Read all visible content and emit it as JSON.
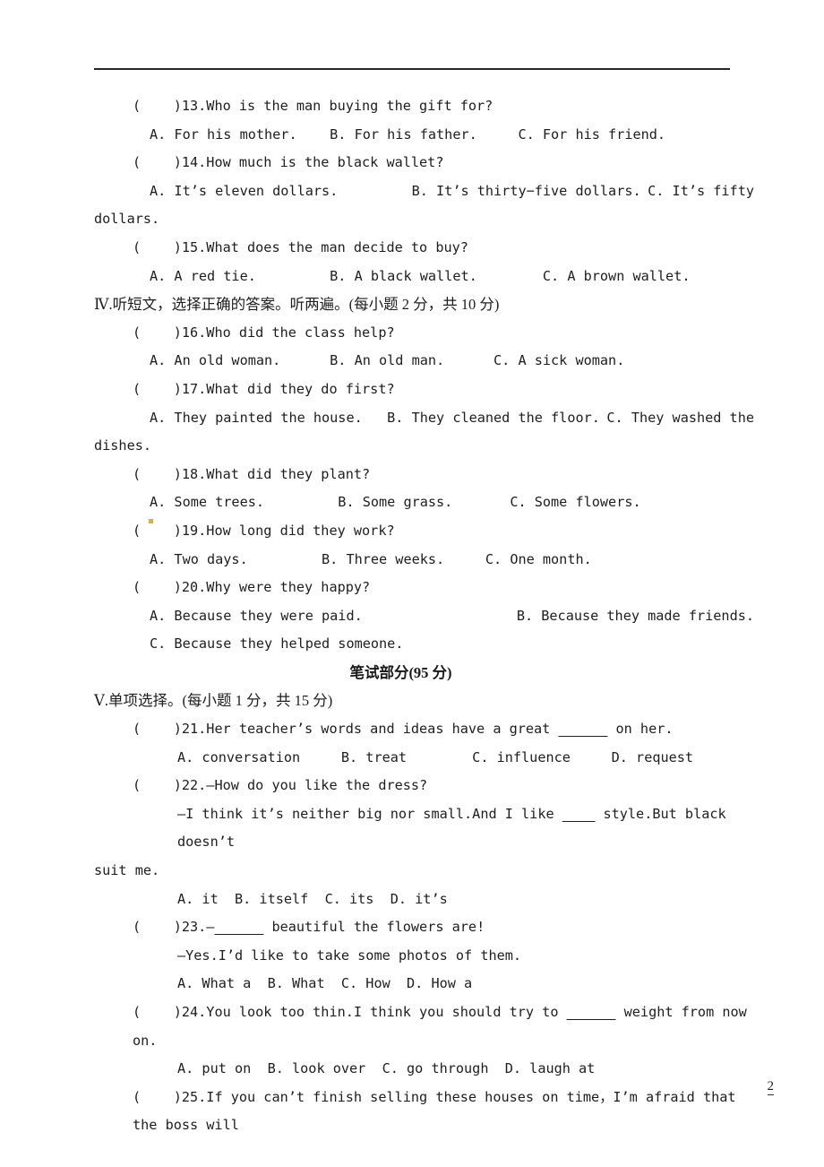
{
  "page": {
    "number": "2",
    "rule_color": "#262626"
  },
  "listening_section_3": {
    "questions": [
      {
        "marker": "(    )13.",
        "stem": "Who is the man buying the gift for?",
        "options_line": "A. For his mother.    B. For his father.     C. For his friend."
      },
      {
        "marker": "(    )14.",
        "stem": "How much is the black wallet?",
        "options_line_left": "A. It’s eleven dollars.         B. It’s thirty−five dollars.",
        "options_line_right": "C. It’s fifty",
        "options_wrap": "dollars."
      },
      {
        "marker": "(    )15.",
        "stem": "What does the man decide to buy?",
        "options_line": "A. A red tie.         B. A black wallet.        C. A brown wallet."
      }
    ]
  },
  "section_iv": {
    "heading": "Ⅳ.听短文，选择正确的答案。听两遍。(每小题 2 分，共 10 分)",
    "questions": [
      {
        "marker": "(    )16.",
        "stem": "Who did the class help?",
        "options_line": "A. An old woman.      B. An old man.      C. A sick woman."
      },
      {
        "marker": "(    )17.",
        "stem": "What did they do first?",
        "options_line_left": "A. They painted the house.   B. They cleaned the floor.",
        "options_line_right": "C. They washed the",
        "options_wrap": "dishes."
      },
      {
        "marker": "(    )18.",
        "stem": "What did they plant?",
        "options_line": "A. Some trees.         B. Some grass.       C. Some flowers."
      },
      {
        "marker": "(    )19.",
        "stem": "How long did they work?",
        "options_line": "A. Two days.         B. Three weeks.     C. One month."
      },
      {
        "marker": "(    )20.",
        "stem": "Why were they happy?",
        "options_line_a": "A. Because they were paid.",
        "options_line_b": "B. Because they made friends.",
        "options_line_c": "C. Because they helped someone."
      }
    ]
  },
  "written_part": {
    "heading": "笔试部分(95 分)"
  },
  "section_v": {
    "heading": "Ⅴ.单项选择。(每小题 1 分，共 15 分)",
    "questions": [
      {
        "marker": "(    )21.",
        "stem_before": "Her teacher’s words and ideas have a great ",
        "blank": "______",
        "stem_after": " on her.",
        "options_line": "A. conversation     B. treat        C. influence     D. request"
      },
      {
        "marker": "(    )22.",
        "stem": "—How do you like the dress?",
        "reply_before": "—I think it’s neither big nor small.And I like ",
        "reply_blank": "____",
        "reply_after": " style.But black doesn’t",
        "reply_wrap": "suit me.",
        "options_line": "A. it  B. itself  C. its  D. it’s"
      },
      {
        "marker": "(    )23.",
        "stem_before": "—",
        "blank": "______",
        "stem_after": " beautiful the flowers are!",
        "reply": "—Yes.I’d like to take some photos of them.",
        "options_line": "A. What a  B. What  C. How  D. How a"
      },
      {
        "marker": "(    )24.",
        "stem_before": "You look too thin.I think you should try to ",
        "blank": "______",
        "stem_after": " weight from now on.",
        "options_line": "A. put on  B. look over  C. go through  D. laugh at"
      },
      {
        "marker": "(    )25.",
        "stem_left": "If you can’t finish selling these houses on time，I’m afraid that the boss will",
        "stem_right": ""
      }
    ]
  }
}
